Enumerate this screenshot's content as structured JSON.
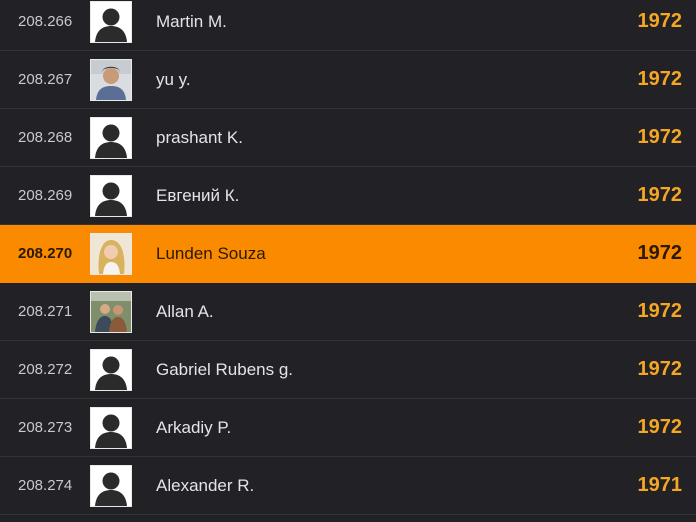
{
  "colors": {
    "background": "#222226",
    "highlight": "#fa8a00",
    "rating": "#f5a623"
  },
  "leaderboard": {
    "rows": [
      {
        "rank": "208.266",
        "name": "Martin M.",
        "rating": "1972",
        "avatar": "silhouette-icon"
      },
      {
        "rank": "208.267",
        "name": "yu y.",
        "rating": "1972",
        "avatar": "photo"
      },
      {
        "rank": "208.268",
        "name": "prashant K.",
        "rating": "1972",
        "avatar": "silhouette-icon"
      },
      {
        "rank": "208.269",
        "name": "Евгений К.",
        "rating": "1972",
        "avatar": "silhouette-icon"
      },
      {
        "rank": "208.270",
        "name": "Lunden Souza",
        "rating": "1972",
        "avatar": "photo",
        "current_user": true
      },
      {
        "rank": "208.271",
        "name": "Allan A.",
        "rating": "1972",
        "avatar": "photo"
      },
      {
        "rank": "208.272",
        "name": "Gabriel Rubens g.",
        "rating": "1972",
        "avatar": "silhouette-icon"
      },
      {
        "rank": "208.273",
        "name": "Arkadiy P.",
        "rating": "1972",
        "avatar": "silhouette-icon"
      },
      {
        "rank": "208.274",
        "name": "Alexander R.",
        "rating": "1971",
        "avatar": "silhouette-icon"
      }
    ]
  }
}
